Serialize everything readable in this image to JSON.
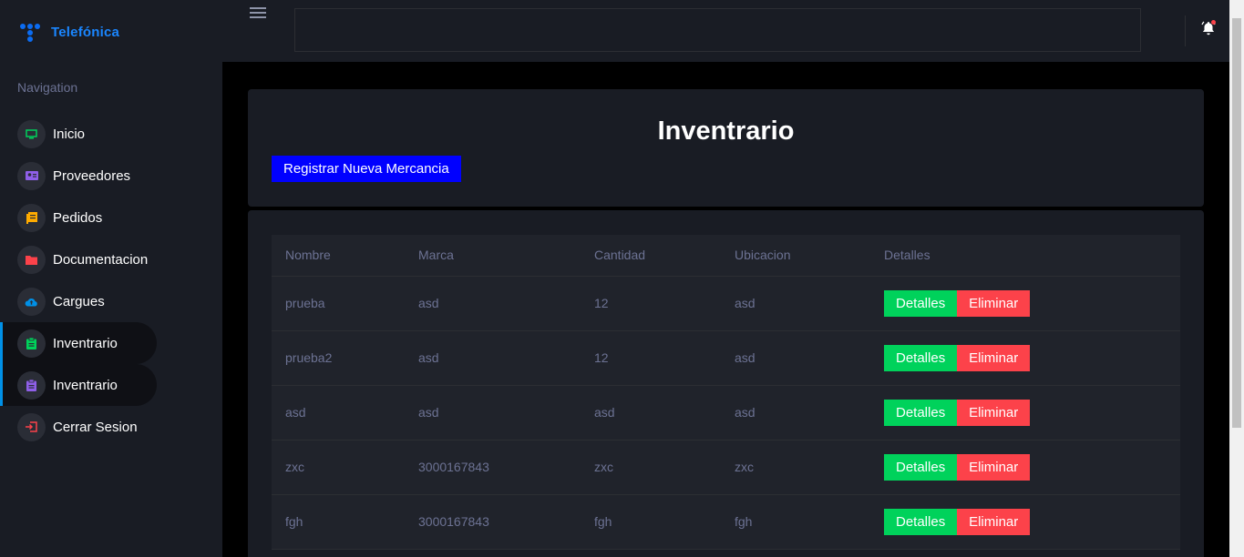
{
  "brand": {
    "name": "Telefónica"
  },
  "sidebar": {
    "heading": "Navigation",
    "items": [
      {
        "label": "Inicio",
        "icon": "monitor-icon",
        "color": "#00d25b"
      },
      {
        "label": "Proveedores",
        "icon": "id-card-icon",
        "color": "#8f5fe8"
      },
      {
        "label": "Pedidos",
        "icon": "document-icon",
        "color": "#ffab00"
      },
      {
        "label": "Documentacion",
        "icon": "folder-icon",
        "color": "#fc424a"
      },
      {
        "label": "Cargues",
        "icon": "cloud-upload-icon",
        "color": "#0090e7"
      },
      {
        "label": "Inventrario",
        "icon": "clipboard-icon",
        "color": "#00d25b"
      },
      {
        "label": "Inventrario",
        "icon": "clipboard-icon",
        "color": "#8f5fe8"
      },
      {
        "label": "Cerrar Sesion",
        "icon": "logout-icon",
        "color": "#fc424a"
      }
    ]
  },
  "header": {
    "title": "Inventrario",
    "register_button": "Registrar Nueva Mercancia"
  },
  "table": {
    "columns": [
      "Nombre",
      "Marca",
      "Cantidad",
      "Ubicacion",
      "Detalles"
    ],
    "rows": [
      [
        "prueba",
        "asd",
        "12",
        "asd"
      ],
      [
        "prueba2",
        "asd",
        "12",
        "asd"
      ],
      [
        "asd",
        "asd",
        "asd",
        "asd"
      ],
      [
        "zxc",
        "3000167843",
        "zxc",
        "zxc"
      ],
      [
        "fgh",
        "3000167843",
        "fgh",
        "fgh"
      ]
    ],
    "details_label": "Detalles",
    "delete_label": "Eliminar"
  },
  "colors": {
    "accent_blue": "#0000ff",
    "success": "#00d25b",
    "danger": "#fc424a",
    "notification_dot": "#fc424a"
  }
}
